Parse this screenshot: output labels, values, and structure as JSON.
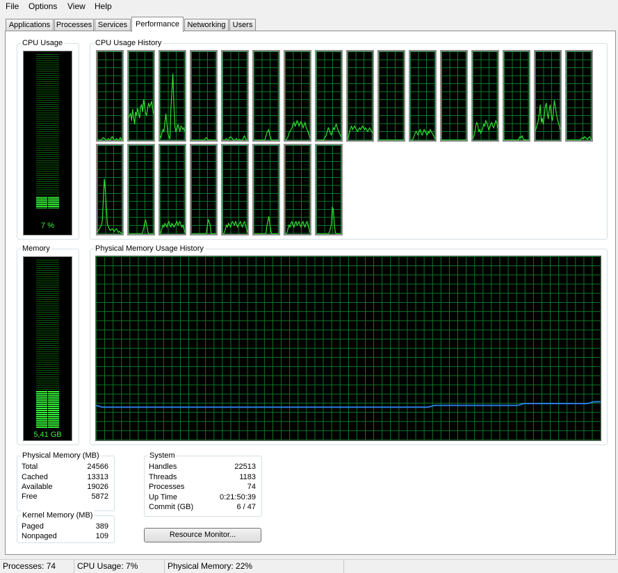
{
  "menu": [
    "File",
    "Options",
    "View",
    "Help"
  ],
  "tabs": [
    "Applications",
    "Processes",
    "Services",
    "Performance",
    "Networking",
    "Users"
  ],
  "active_tab": "Performance",
  "cpu_usage": {
    "title": "CPU Usage",
    "label": "7 %",
    "level": 0.07
  },
  "cpu_history": {
    "title": "CPU Usage History",
    "cores": [
      [
        0,
        0,
        0,
        0,
        0,
        2,
        3,
        2,
        1,
        0,
        0,
        2,
        1,
        0,
        3,
        4,
        2,
        0,
        0,
        2,
        1,
        0,
        1,
        3,
        0,
        2
      ],
      [
        25,
        28,
        30,
        22,
        35,
        26,
        18,
        32,
        28,
        36,
        30,
        25,
        38,
        40,
        32,
        46,
        38,
        30,
        28,
        36,
        42,
        38,
        40,
        44,
        35,
        30
      ],
      [
        5,
        3,
        8,
        12,
        10,
        20,
        30,
        18,
        8,
        4,
        2,
        35,
        55,
        75,
        40,
        15,
        10,
        12,
        18,
        14,
        10,
        16,
        15,
        12,
        14,
        10
      ],
      [
        0,
        0,
        0,
        0,
        0,
        0,
        0,
        0,
        0,
        0,
        0,
        0,
        0,
        0,
        2,
        3,
        2,
        0,
        0,
        0,
        0,
        0,
        0,
        0,
        0,
        0
      ],
      [
        0,
        0,
        0,
        1,
        2,
        0,
        0,
        3,
        4,
        3,
        2,
        0,
        0,
        1,
        2,
        0,
        0,
        1,
        0,
        0,
        0,
        3,
        5,
        2,
        0,
        0
      ],
      [
        0,
        0,
        0,
        0,
        0,
        0,
        0,
        0,
        0,
        0,
        0,
        0,
        4,
        8,
        10,
        12,
        6,
        2,
        0,
        0,
        0,
        0,
        0,
        0,
        0,
        0
      ],
      [
        0,
        0,
        2,
        4,
        8,
        10,
        12,
        14,
        18,
        20,
        16,
        18,
        22,
        20,
        16,
        19,
        21,
        18,
        14,
        17,
        20,
        15,
        12,
        10,
        6,
        3
      ],
      [
        0,
        0,
        0,
        0,
        0,
        0,
        0,
        0,
        2,
        4,
        6,
        10,
        14,
        12,
        8,
        6,
        10,
        14,
        12,
        16,
        18,
        14,
        10,
        8,
        6,
        4
      ],
      [
        0,
        4,
        10,
        14,
        16,
        12,
        14,
        16,
        14,
        12,
        10,
        12,
        14,
        12,
        14,
        16,
        14,
        12,
        14,
        12,
        10,
        12,
        14,
        12,
        10,
        8
      ],
      [
        0,
        0,
        0,
        0,
        0,
        0,
        0,
        0,
        0,
        0,
        0,
        0,
        0,
        0,
        0,
        0,
        0,
        0,
        0,
        0,
        0,
        0,
        0,
        0,
        0,
        0
      ],
      [
        0,
        0,
        0,
        2,
        5,
        8,
        10,
        8,
        6,
        10,
        12,
        8,
        6,
        9,
        12,
        10,
        8,
        6,
        10,
        8,
        12,
        10,
        8,
        6,
        4,
        2
      ],
      [
        0,
        0,
        0,
        0,
        0,
        0,
        0,
        0,
        0,
        0,
        0,
        0,
        0,
        0,
        0,
        0,
        0,
        0,
        0,
        0,
        0,
        0,
        0,
        0,
        0,
        0
      ],
      [
        2,
        4,
        8,
        16,
        20,
        18,
        10,
        12,
        8,
        10,
        14,
        18,
        16,
        22,
        20,
        16,
        12,
        14,
        18,
        20,
        16,
        14,
        18,
        22,
        20,
        14
      ],
      [
        0,
        0,
        0,
        0,
        0,
        0,
        0,
        0,
        0,
        0,
        0,
        0,
        0,
        0,
        0,
        2,
        4,
        3,
        5,
        2,
        0,
        1,
        0,
        0,
        0,
        0
      ],
      [
        10,
        14,
        18,
        22,
        30,
        40,
        20,
        25,
        18,
        28,
        38,
        42,
        30,
        24,
        35,
        40,
        28,
        22,
        30,
        45,
        38,
        30,
        24,
        20,
        16,
        12
      ],
      [
        0,
        0,
        0,
        0,
        0,
        0,
        0,
        0,
        0,
        0,
        0,
        0,
        0,
        0,
        1,
        2,
        3,
        2,
        4,
        3,
        2,
        1,
        3,
        4,
        2,
        0
      ],
      [
        2,
        4,
        6,
        8,
        10,
        15,
        38,
        62,
        50,
        30,
        12,
        8,
        6,
        4,
        5,
        6,
        4,
        3,
        5,
        6,
        4,
        2,
        3,
        2,
        1,
        0
      ],
      [
        0,
        0,
        0,
        0,
        0,
        0,
        0,
        0,
        0,
        0,
        0,
        0,
        0,
        0,
        2,
        6,
        12,
        16,
        10,
        4,
        0,
        0,
        0,
        0,
        0,
        0
      ],
      [
        0,
        2,
        6,
        10,
        8,
        12,
        10,
        8,
        12,
        14,
        10,
        8,
        12,
        10,
        8,
        10,
        12,
        14,
        10,
        12,
        14,
        10,
        8,
        10,
        6,
        2
      ],
      [
        0,
        0,
        0,
        0,
        0,
        0,
        0,
        0,
        0,
        0,
        0,
        0,
        0,
        0,
        0,
        0,
        8,
        16,
        14,
        10,
        0,
        0,
        0,
        0,
        0,
        0
      ],
      [
        0,
        0,
        2,
        6,
        10,
        8,
        12,
        10,
        8,
        12,
        14,
        12,
        10,
        14,
        12,
        8,
        10,
        12,
        14,
        10,
        8,
        12,
        14,
        10,
        6,
        2
      ],
      [
        0,
        0,
        0,
        0,
        0,
        0,
        0,
        0,
        0,
        0,
        0,
        0,
        0,
        8,
        14,
        20,
        12,
        4,
        0,
        0,
        0,
        0,
        0,
        0,
        0,
        0
      ],
      [
        0,
        0,
        2,
        6,
        10,
        8,
        12,
        14,
        10,
        8,
        12,
        14,
        10,
        12,
        14,
        10,
        8,
        12,
        14,
        10,
        8,
        12,
        14,
        10,
        6,
        2
      ],
      [
        0,
        0,
        0,
        0,
        0,
        0,
        0,
        0,
        0,
        0,
        0,
        0,
        0,
        2,
        6,
        10,
        30,
        28,
        12,
        2,
        0,
        0,
        0,
        0,
        0,
        0
      ]
    ]
  },
  "memory": {
    "title": "Memory",
    "label": "5,41 GB",
    "level": 0.22
  },
  "mem_history": {
    "title": "Physical Memory Usage History",
    "values": [
      19,
      18,
      18,
      18,
      18,
      18,
      18,
      18,
      18,
      18,
      18,
      18,
      18,
      18,
      18,
      18,
      18,
      18,
      18,
      18,
      18,
      18,
      18,
      18,
      18,
      18,
      18,
      18,
      18,
      18,
      18,
      18,
      18,
      18,
      18,
      18,
      18,
      18,
      18,
      18,
      18,
      18,
      18,
      18,
      18,
      18,
      18,
      18,
      18,
      18,
      18,
      18,
      18,
      19,
      19,
      19,
      19,
      19,
      19,
      19,
      19,
      19,
      19,
      19,
      19,
      19,
      19,
      20,
      20,
      20,
      20,
      20,
      20,
      20,
      20,
      20,
      20,
      20,
      21,
      21
    ]
  },
  "physical_memory": {
    "title": "Physical Memory (MB)",
    "rows": [
      {
        "name": "Total",
        "value": "24566"
      },
      {
        "name": "Cached",
        "value": "13313"
      },
      {
        "name": "Available",
        "value": "19026"
      },
      {
        "name": "Free",
        "value": "5872"
      }
    ]
  },
  "kernel_memory": {
    "title": "Kernel Memory (MB)",
    "rows": [
      {
        "name": "Paged",
        "value": "389"
      },
      {
        "name": "Nonpaged",
        "value": "109"
      }
    ]
  },
  "system": {
    "title": "System",
    "rows": [
      {
        "name": "Handles",
        "value": "22513"
      },
      {
        "name": "Threads",
        "value": "1183"
      },
      {
        "name": "Processes",
        "value": "74"
      },
      {
        "name": "Up Time",
        "value": "0:21:50:39"
      },
      {
        "name": "Commit (GB)",
        "value": "6 / 47"
      }
    ]
  },
  "resource_monitor_button": "Resource Monitor...",
  "status": {
    "processes": "Processes: 74",
    "cpu": "CPU Usage: 7%",
    "memory": "Physical Memory: 22%"
  },
  "colors": {
    "graph_line": "#31e131",
    "mem_line": "#2a7de1",
    "meter_on": "#37f237"
  }
}
